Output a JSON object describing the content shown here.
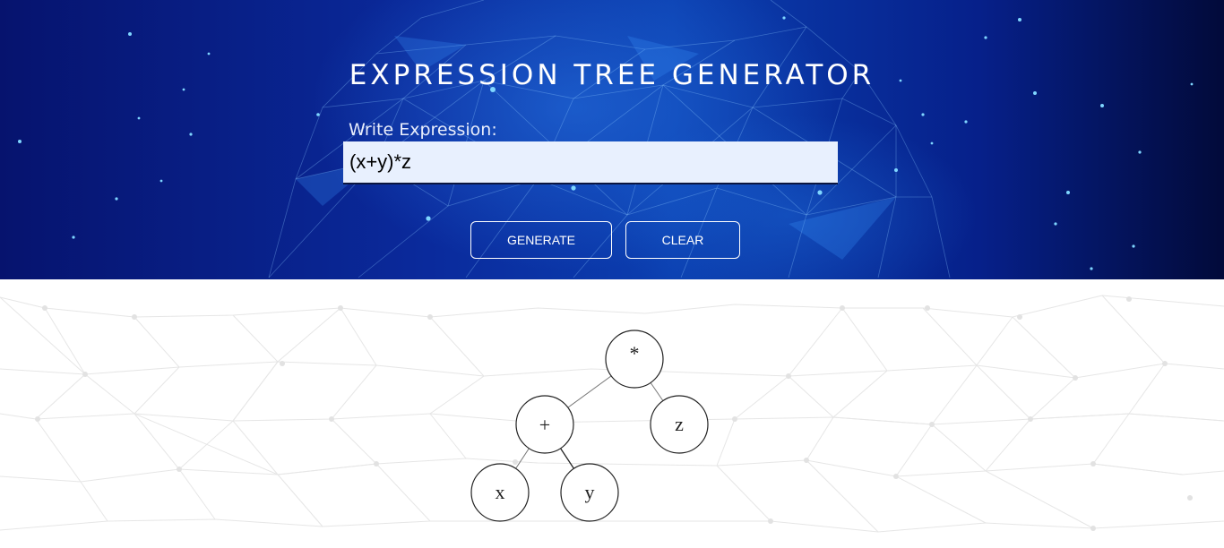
{
  "header": {
    "title": "EXPRESSION TREE GENERATOR"
  },
  "form": {
    "label": "Write Expression:",
    "expression_value": "(x+y)*z"
  },
  "buttons": {
    "generate_label": "GENERATE",
    "clear_label": "CLEAR"
  },
  "tree": {
    "root": {
      "label": "*"
    },
    "plus": {
      "label": "+"
    },
    "z": {
      "label": "z"
    },
    "x": {
      "label": "x"
    },
    "y": {
      "label": "y"
    }
  },
  "colors": {
    "header_dark": "#06136e",
    "header_mid": "#0b3fb0",
    "input_bg": "#e8f0fe",
    "node_stroke": "#222222"
  }
}
